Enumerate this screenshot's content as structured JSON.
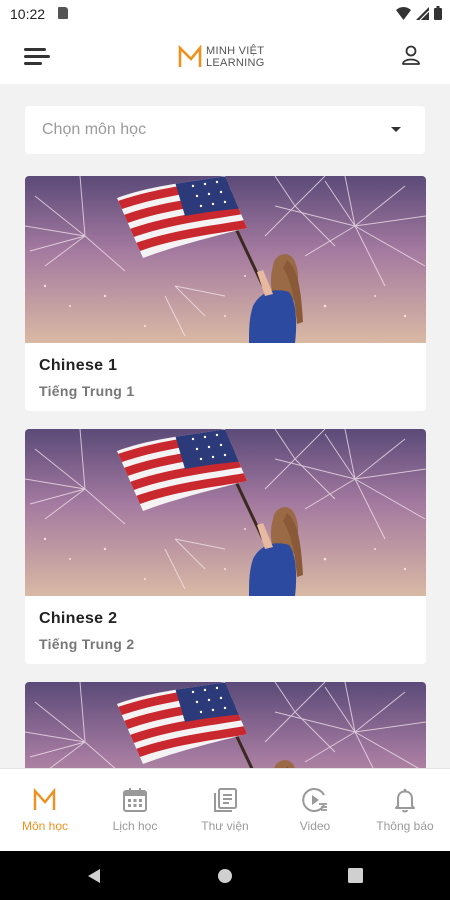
{
  "status_bar": {
    "time": "10:22"
  },
  "app_bar": {
    "logo_line1": "MINH VIỆT",
    "logo_line2": "LEARNING"
  },
  "subject_select": {
    "placeholder": "Chọn môn học"
  },
  "courses": [
    {
      "title": "Chinese 1",
      "subtitle": "Tiếng Trung 1"
    },
    {
      "title": "Chinese 2",
      "subtitle": "Tiếng Trung 2"
    },
    {
      "title": "",
      "subtitle": ""
    }
  ],
  "bottom_nav": {
    "items": [
      {
        "label": "Môn học",
        "icon": "m-logo-icon",
        "active": true
      },
      {
        "label": "Lịch học",
        "icon": "calendar-icon",
        "active": false
      },
      {
        "label": "Thư viện",
        "icon": "library-icon",
        "active": false
      },
      {
        "label": "Video",
        "icon": "video-play-icon",
        "active": false
      },
      {
        "label": "Thông báo",
        "icon": "bell-icon",
        "active": false
      }
    ]
  },
  "colors": {
    "accent": "#f0901e",
    "inactive": "#9a9a9a",
    "background": "#f2f2f2"
  }
}
